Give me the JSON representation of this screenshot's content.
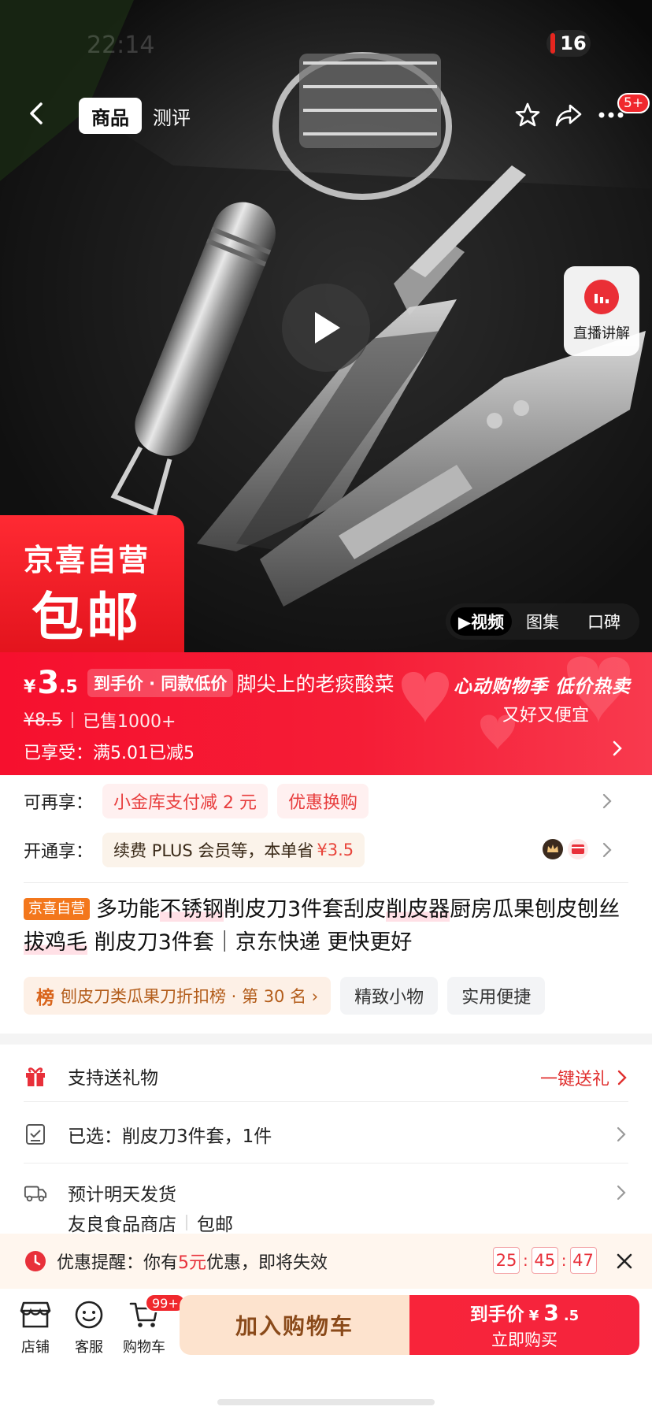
{
  "status_bar": {
    "time": "22:14",
    "battery": "16"
  },
  "nav": {
    "tabs": [
      {
        "label": "商品",
        "active": true
      },
      {
        "label": "测评",
        "active": false
      }
    ],
    "more_badge": "5+"
  },
  "hero": {
    "live_label": "直播讲解",
    "brand_tag_line1": "京喜自营",
    "brand_tag_line2": "包邮",
    "media_tabs": [
      {
        "label": "▶视频",
        "active": true
      },
      {
        "label": "图集",
        "active": false
      },
      {
        "label": "口碑",
        "active": false
      }
    ]
  },
  "price_banner": {
    "currency": "¥",
    "price_int": "3",
    "price_dec": ".5",
    "price_tag": "到手价 · 同款低价",
    "slogan": "脚尖上的老痰酸菜",
    "promo_title": "心动购物季 低价热卖",
    "promo_sub": "又好又便宜",
    "original_price": "¥8.5",
    "sold": "已售1000+",
    "enjoyed": "已享受：满5.01已减5"
  },
  "coupons": {
    "row1_label": "可再享：",
    "row1_chips": [
      "小金库支付减 2 元",
      "优惠换购"
    ],
    "row2_label": "开通享：",
    "row2_text": "续费 PLUS 会员等，本单省",
    "row2_amount": "¥3.5"
  },
  "product": {
    "badge": "京喜自营",
    "title_parts": [
      {
        "text": "多功能",
        "hl": false
      },
      {
        "text": "不锈钢",
        "hl": true
      },
      {
        "text": "削皮刀3件套刮皮",
        "hl": false
      },
      {
        "text": "削皮器",
        "hl": true
      },
      {
        "text": "厨房瓜果刨皮刨丝",
        "hl": false
      },
      {
        "text": "拔鸡毛",
        "hl": true
      },
      {
        "text": " 削皮刀3件套｜京东快递 更快更好",
        "hl": false
      }
    ],
    "rank_icon": "榜",
    "rank_text": "刨皮刀类瓜果刀折扣榜 · 第 30 名 ›",
    "tags": [
      "精致小物",
      "实用便捷"
    ]
  },
  "info_rows": {
    "gift": "支持送礼物",
    "gift_action": "一键送礼",
    "selected": "已选：削皮刀3件套，1件",
    "shipping": "预计明天发货",
    "shop": "友良食品商店",
    "shop_extra": "包邮"
  },
  "reminder": {
    "prefix": "优惠提醒：你有",
    "amount": "5元",
    "suffix": "优惠，即将失效",
    "countdown": [
      "25",
      "45",
      "47"
    ]
  },
  "bottom_bar": {
    "store": "店铺",
    "service": "客服",
    "cart": "购物车",
    "cart_badge": "99+",
    "add_cart": "加入购物车",
    "buy_prefix": "到手价",
    "buy_currency": "¥",
    "buy_int": "3",
    "buy_dec": ".5",
    "buy_now": "立即购买"
  },
  "colors": {
    "brand_red": "#f0282d",
    "price_red": "#e8303a",
    "cart_bg": "#fde3ce",
    "self_badge": "#f3771c"
  },
  "icons": [
    "back-icon",
    "star-icon",
    "share-icon",
    "more-icon",
    "play-icon",
    "live-icon",
    "gift-icon",
    "selected-icon",
    "truck-icon",
    "clock-icon",
    "close-icon",
    "store-icon",
    "service-icon",
    "cart-icon"
  ]
}
